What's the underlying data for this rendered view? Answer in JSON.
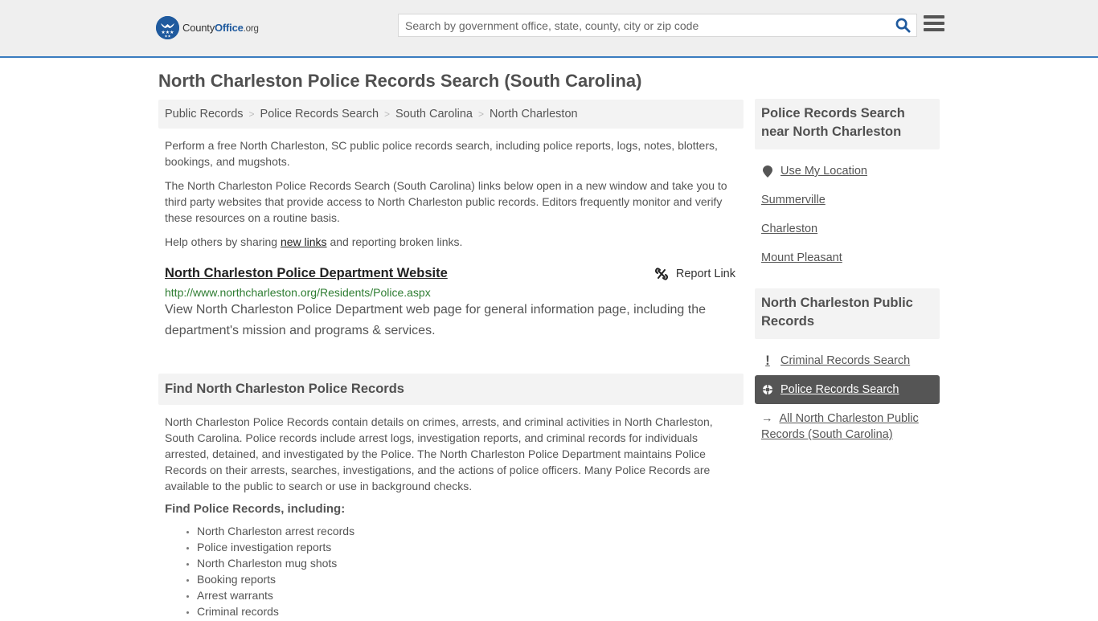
{
  "header": {
    "logo": {
      "name": "County",
      "name_bold": "Office",
      "tld": ".org"
    },
    "search": {
      "placeholder": "Search by government office, state, county, city or zip code",
      "value": ""
    }
  },
  "page_title": "North Charleston Police Records Search (South Carolina)",
  "breadcrumb": [
    {
      "label": "Public Records"
    },
    {
      "label": "Police Records Search"
    },
    {
      "label": "South Carolina"
    },
    {
      "label": "North Charleston"
    }
  ],
  "intro": {
    "p1": "Perform a free North Charleston, SC public police records search, including police reports, logs, notes, blotters, bookings, and mugshots.",
    "p2": "The North Charleston Police Records Search (South Carolina) links below open in a new window and take you to third party websites that provide access to North Charleston public records. Editors frequently monitor and verify these resources on a routine basis.",
    "p3_before": "Help others by sharing ",
    "p3_link": "new links",
    "p3_after": " and reporting broken links."
  },
  "resource": {
    "title": "North Charleston Police Department Website",
    "url": "http://www.northcharleston.org/Residents/Police.aspx",
    "description": "View North Charleston Police Department web page for general information page, including the department's mission and programs & services.",
    "report_label": "Report Link"
  },
  "find_section": {
    "heading": "Find North Charleston Police Records",
    "body": "North Charleston Police Records contain details on crimes, arrests, and criminal activities in North Charleston, South Carolina. Police records include arrest logs, investigation reports, and criminal records for individuals arrested, detained, and investigated by the Police. The North Charleston Police Department maintains Police Records on their arrests, searches, investigations, and the actions of police officers. Many Police Records are available to the public to search or use in background checks.",
    "subheading": "Find Police Records, including:",
    "items": [
      "North Charleston arrest records",
      "Police investigation reports",
      "North Charleston mug shots",
      "Booking reports",
      "Arrest warrants",
      "Criminal records"
    ]
  },
  "sidebar": {
    "nearby": {
      "heading": "Police Records Search near North Charleston",
      "use_location": "Use My Location",
      "links": [
        "Summerville",
        "Charleston",
        "Mount Pleasant"
      ]
    },
    "public_records": {
      "heading": "North Charleston Public Records",
      "links": [
        {
          "label": "Criminal Records Search",
          "icon": "exclamation-icon",
          "active": false
        },
        {
          "label": "Police Records Search",
          "icon": "crosshair-icon",
          "active": true
        },
        {
          "label": "All North Charleston Public Records (South Carolina)",
          "icon": "arrow-right-icon",
          "active": false
        }
      ]
    }
  },
  "colors": {
    "brand_blue": "#1f5a9e",
    "header_border": "#3a7cbf",
    "url_green": "#2e7d32",
    "active_bg": "#555555"
  }
}
